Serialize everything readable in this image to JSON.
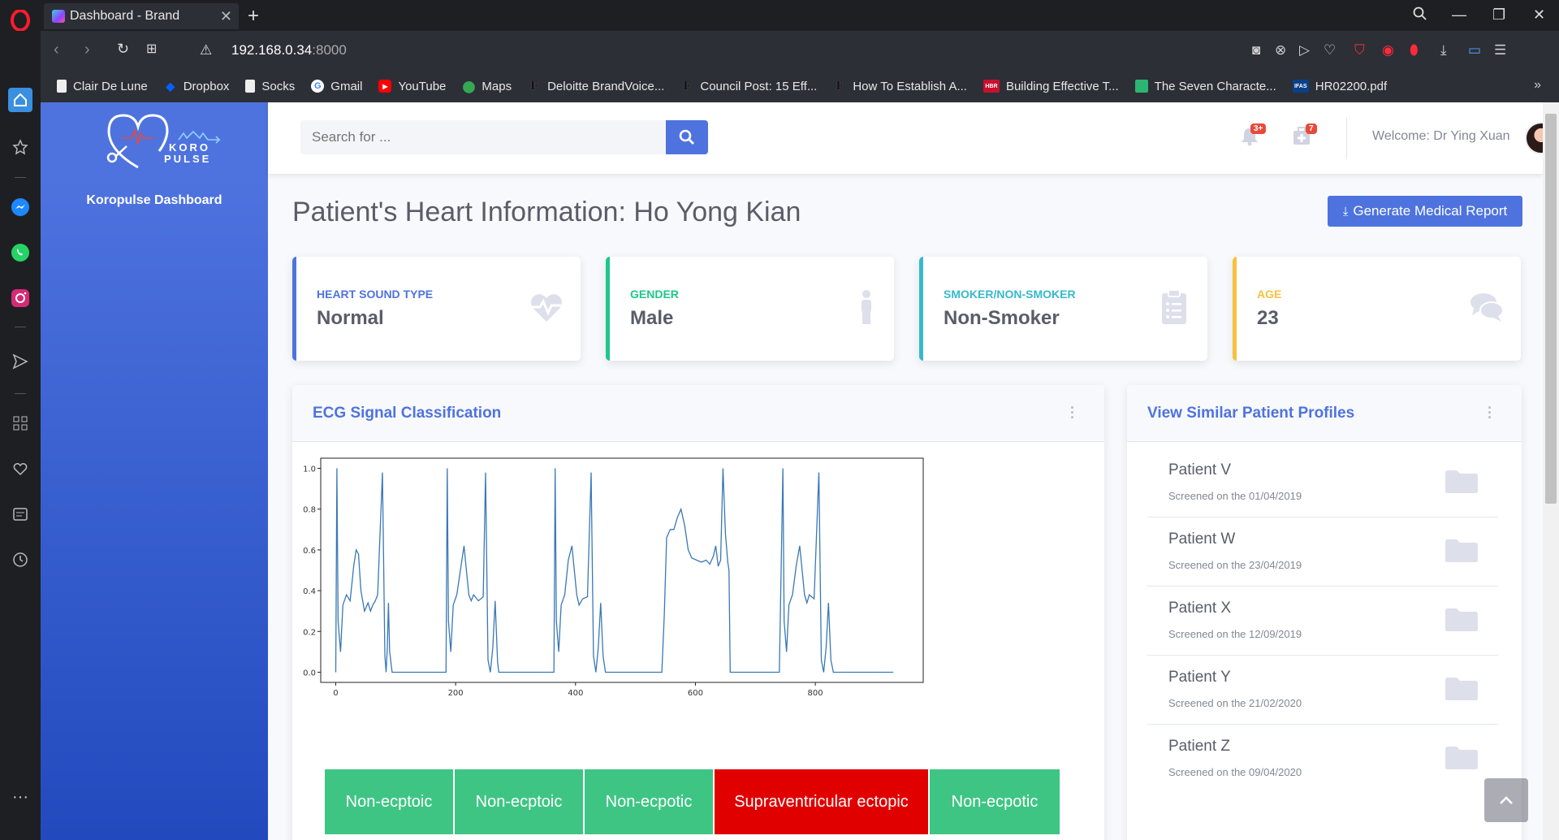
{
  "browser": {
    "tab_title": "Dashboard - Brand",
    "url_host": "192.168.0.34",
    "url_port": ":8000",
    "bookmarks": [
      {
        "label": "Clair De Lune",
        "icon": "page-icon"
      },
      {
        "label": "Dropbox",
        "icon": "dropbox-icon"
      },
      {
        "label": "Socks",
        "icon": "page-icon"
      },
      {
        "label": "Gmail",
        "icon": "google-icon"
      },
      {
        "label": "YouTube",
        "icon": "youtube-icon"
      },
      {
        "label": "Maps",
        "icon": "maps-icon"
      },
      {
        "label": "Deloitte BrandVoice...",
        "icon": "forbes-icon"
      },
      {
        "label": "Council Post: 15 Eff...",
        "icon": "forbes-icon"
      },
      {
        "label": "How To Establish A...",
        "icon": "forbes-icon"
      },
      {
        "label": "Building Effective T...",
        "icon": "hbr-icon"
      },
      {
        "label": "The Seven Characte...",
        "icon": "bookmark-green-icon"
      },
      {
        "label": "HR02200.pdf",
        "icon": "ifas-icon"
      }
    ],
    "bookmarks_more": "»"
  },
  "sidebar": {
    "logo_line1": "KORO",
    "logo_line2": "PULSE",
    "title": "Koropulse Dashboard"
  },
  "topbar": {
    "search_placeholder": "Search for ...",
    "alerts_badge": "3+",
    "messages_badge": "7",
    "welcome": "Welcome:  Dr Ying Xuan"
  },
  "page": {
    "title": "Patient's Heart Information: Ho Yong Kian",
    "report_button": "Generate Medical Report"
  },
  "cards": [
    {
      "label": "HEART SOUND TYPE",
      "value": "Normal",
      "color": "#4e73df",
      "icon": "heartbeat-icon"
    },
    {
      "label": "GENDER",
      "value": "Male",
      "color": "#1cc88a",
      "icon": "male-icon"
    },
    {
      "label": "SMOKER/NON-SMOKER",
      "value": "Non-Smoker",
      "color": "#36b9cc",
      "icon": "clipboard-list-icon"
    },
    {
      "label": "AGE",
      "value": "23",
      "color": "#f6c23e",
      "icon": "comments-icon"
    }
  ],
  "ecg_panel": {
    "title": "ECG Signal Classification",
    "classifications": [
      {
        "label": "Non-ecptoic",
        "color": "#3ec584"
      },
      {
        "label": "Non-ecptoic",
        "color": "#3ec584"
      },
      {
        "label": "Non-ecpotic",
        "color": "#3ec584"
      },
      {
        "label": "Supraventricular ectopic",
        "color": "#e00000"
      },
      {
        "label": "Non-ecpotic",
        "color": "#3ec584"
      }
    ]
  },
  "similar_panel": {
    "title": "View Similar Patient Profiles",
    "patients": [
      {
        "name": "Patient V",
        "date": "Screened on the 01/04/2019"
      },
      {
        "name": "Patient W",
        "date": "Screened on the 23/04/2019"
      },
      {
        "name": "Patient X",
        "date": "Screened on the 12/09/2019"
      },
      {
        "name": "Patient Y",
        "date": "Screened on the 21/02/2020"
      },
      {
        "name": "Patient Z",
        "date": "Screened on the 09/04/2020"
      }
    ]
  },
  "chart_data": {
    "type": "line",
    "title": "",
    "xlabel": "",
    "ylabel": "",
    "xlim": [
      -25,
      980
    ],
    "ylim": [
      -0.05,
      1.05
    ],
    "xticks": [
      0,
      200,
      400,
      600,
      800
    ],
    "yticks": [
      0.0,
      0.2,
      0.4,
      0.6,
      0.8,
      1.0
    ],
    "ytick_labels": [
      "0.0",
      "0.2",
      "0.4",
      "0.6",
      "0.8",
      "1.0"
    ],
    "line_color": "#3a78b5",
    "series": [
      {
        "x": [
          0,
          2,
          4,
          8,
          12,
          18,
          24,
          30,
          34,
          38,
          42,
          48,
          54,
          58,
          62,
          66,
          70,
          78,
          82,
          84,
          86,
          88,
          90,
          94,
          100,
          180,
          184,
          186,
          188,
          192,
          196,
          202,
          208,
          214,
          218,
          222,
          226,
          230,
          238,
          246,
          250,
          254,
          258,
          262,
          266,
          270,
          272,
          274,
          276,
          280,
          360,
          364,
          366,
          368,
          372,
          376,
          382,
          388,
          394,
          398,
          402,
          406,
          412,
          420,
          426,
          430,
          434,
          438,
          442,
          446,
          450,
          452,
          454,
          456,
          460,
          540,
          544,
          546,
          548,
          552,
          556,
          560,
          564,
          570,
          576,
          580,
          584,
          590,
          596,
          604,
          612,
          620,
          630,
          636,
          640,
          644,
          650,
          654,
          656,
          658,
          660,
          664,
          670,
          672,
          674,
          680,
          720,
          740,
          744,
          746,
          748,
          752,
          756,
          762,
          768,
          774,
          778,
          782,
          786,
          790,
          798,
          806,
          810,
          814,
          818,
          822,
          826,
          830,
          832,
          834,
          836,
          838,
          840,
          846,
          860,
          930
        ],
        "y": [
          0.0,
          1.0,
          0.25,
          0.1,
          0.33,
          0.38,
          0.35,
          0.52,
          0.6,
          0.58,
          0.4,
          0.3,
          0.34,
          0.3,
          0.33,
          0.35,
          0.38,
          0.98,
          0.08,
          0.0,
          0.12,
          0.34,
          0.1,
          0.0,
          0.0,
          0.0,
          0.0,
          1.0,
          0.25,
          0.1,
          0.33,
          0.38,
          0.5,
          0.62,
          0.5,
          0.38,
          0.35,
          0.38,
          0.35,
          0.37,
          0.98,
          0.06,
          0.0,
          0.12,
          0.35,
          0.05,
          0.0,
          0.0,
          0.0,
          0.0,
          0.0,
          0.0,
          1.0,
          0.25,
          0.1,
          0.33,
          0.38,
          0.55,
          0.62,
          0.5,
          0.38,
          0.33,
          0.36,
          0.37,
          0.98,
          0.08,
          0.0,
          0.12,
          0.34,
          0.08,
          0.0,
          0.0,
          0.0,
          0.0,
          0.0,
          0.0,
          0.0,
          0.0,
          0.0,
          0.0,
          0.0,
          0.0,
          0.0,
          0.0,
          0.0,
          0.0,
          0.0,
          0.0,
          0.0,
          0.0,
          0.0,
          0.0,
          0.0,
          0.0,
          0.0,
          0.0,
          0.0,
          0.0,
          0.0,
          0.0,
          0.0,
          0.0,
          0.0,
          0.0,
          0.0,
          0.0,
          0.0,
          0.0,
          0.0,
          0.0,
          0.0,
          0.0,
          0.0,
          0.0,
          0.0,
          0.0,
          0.0,
          0.0,
          0.0,
          0.0,
          0.0,
          0.0,
          0.0,
          0.0,
          0.0,
          0.0,
          0.0,
          0.0,
          0.0,
          0.0,
          0.0,
          0.0,
          0.0,
          0.0,
          0.0,
          0.0
        ],
        "segments_note": ""
      }
    ],
    "ecg_points": [
      [
        0,
        0.0
      ],
      [
        2,
        1.0
      ],
      [
        4,
        0.25
      ],
      [
        8,
        0.1
      ],
      [
        12,
        0.33
      ],
      [
        18,
        0.38
      ],
      [
        24,
        0.35
      ],
      [
        30,
        0.52
      ],
      [
        34,
        0.6
      ],
      [
        38,
        0.58
      ],
      [
        42,
        0.4
      ],
      [
        48,
        0.3
      ],
      [
        54,
        0.34
      ],
      [
        58,
        0.3
      ],
      [
        62,
        0.33
      ],
      [
        66,
        0.35
      ],
      [
        70,
        0.38
      ],
      [
        78,
        0.98
      ],
      [
        82,
        0.08
      ],
      [
        84,
        0.0
      ],
      [
        86,
        0.12
      ],
      [
        88,
        0.34
      ],
      [
        90,
        0.1
      ],
      [
        94,
        0.0
      ],
      [
        180,
        0.0
      ],
      [
        184,
        0.0
      ],
      [
        186,
        1.0
      ],
      [
        188,
        0.25
      ],
      [
        192,
        0.1
      ],
      [
        196,
        0.33
      ],
      [
        202,
        0.38
      ],
      [
        208,
        0.5
      ],
      [
        214,
        0.62
      ],
      [
        218,
        0.5
      ],
      [
        222,
        0.38
      ],
      [
        226,
        0.35
      ],
      [
        230,
        0.38
      ],
      [
        238,
        0.35
      ],
      [
        246,
        0.37
      ],
      [
        250,
        0.98
      ],
      [
        254,
        0.06
      ],
      [
        258,
        0.0
      ],
      [
        262,
        0.12
      ],
      [
        266,
        0.35
      ],
      [
        270,
        0.05
      ],
      [
        272,
        0.0
      ],
      [
        364,
        0.0
      ],
      [
        366,
        1.0
      ],
      [
        368,
        0.25
      ],
      [
        372,
        0.1
      ],
      [
        376,
        0.33
      ],
      [
        382,
        0.38
      ],
      [
        388,
        0.55
      ],
      [
        394,
        0.62
      ],
      [
        398,
        0.5
      ],
      [
        402,
        0.38
      ],
      [
        406,
        0.33
      ],
      [
        412,
        0.36
      ],
      [
        420,
        0.37
      ],
      [
        426,
        0.98
      ],
      [
        430,
        0.08
      ],
      [
        434,
        0.0
      ],
      [
        438,
        0.12
      ],
      [
        442,
        0.34
      ],
      [
        446,
        0.08
      ],
      [
        450,
        0.0
      ],
      [
        544,
        0.0
      ],
      [
        548,
        0.28
      ],
      [
        552,
        0.66
      ],
      [
        558,
        0.7
      ],
      [
        564,
        0.7
      ],
      [
        570,
        0.76
      ],
      [
        576,
        0.8
      ],
      [
        582,
        0.72
      ],
      [
        588,
        0.6
      ],
      [
        594,
        0.56
      ],
      [
        602,
        0.55
      ],
      [
        610,
        0.54
      ],
      [
        618,
        0.55
      ],
      [
        624,
        0.53
      ],
      [
        630,
        0.57
      ],
      [
        634,
        0.62
      ],
      [
        638,
        0.52
      ],
      [
        642,
        0.55
      ],
      [
        646,
        1.0
      ],
      [
        650,
        0.68
      ],
      [
        654,
        0.54
      ],
      [
        656,
        0.5
      ],
      [
        658,
        0.0
      ],
      [
        740,
        0.0
      ],
      [
        746,
        1.0
      ],
      [
        748,
        0.25
      ],
      [
        752,
        0.1
      ],
      [
        756,
        0.33
      ],
      [
        762,
        0.38
      ],
      [
        768,
        0.52
      ],
      [
        774,
        0.62
      ],
      [
        778,
        0.5
      ],
      [
        782,
        0.38
      ],
      [
        786,
        0.34
      ],
      [
        790,
        0.38
      ],
      [
        798,
        0.36
      ],
      [
        806,
        0.98
      ],
      [
        810,
        0.06
      ],
      [
        814,
        0.0
      ],
      [
        818,
        0.12
      ],
      [
        822,
        0.34
      ],
      [
        826,
        0.06
      ],
      [
        830,
        0.0
      ],
      [
        930,
        0.0
      ]
    ]
  }
}
